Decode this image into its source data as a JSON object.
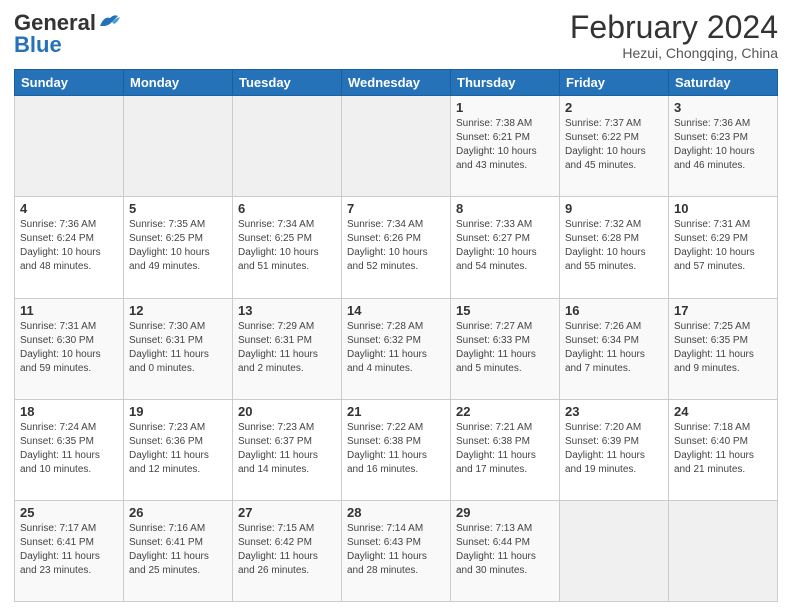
{
  "header": {
    "logo_line1": "General",
    "logo_line2": "Blue",
    "month_year": "February 2024",
    "location": "Hezui, Chongqing, China"
  },
  "days_of_week": [
    "Sunday",
    "Monday",
    "Tuesday",
    "Wednesday",
    "Thursday",
    "Friday",
    "Saturday"
  ],
  "weeks": [
    [
      {
        "day": "",
        "info": ""
      },
      {
        "day": "",
        "info": ""
      },
      {
        "day": "",
        "info": ""
      },
      {
        "day": "",
        "info": ""
      },
      {
        "day": "1",
        "info": "Sunrise: 7:38 AM\nSunset: 6:21 PM\nDaylight: 10 hours\nand 43 minutes."
      },
      {
        "day": "2",
        "info": "Sunrise: 7:37 AM\nSunset: 6:22 PM\nDaylight: 10 hours\nand 45 minutes."
      },
      {
        "day": "3",
        "info": "Sunrise: 7:36 AM\nSunset: 6:23 PM\nDaylight: 10 hours\nand 46 minutes."
      }
    ],
    [
      {
        "day": "4",
        "info": "Sunrise: 7:36 AM\nSunset: 6:24 PM\nDaylight: 10 hours\nand 48 minutes."
      },
      {
        "day": "5",
        "info": "Sunrise: 7:35 AM\nSunset: 6:25 PM\nDaylight: 10 hours\nand 49 minutes."
      },
      {
        "day": "6",
        "info": "Sunrise: 7:34 AM\nSunset: 6:25 PM\nDaylight: 10 hours\nand 51 minutes."
      },
      {
        "day": "7",
        "info": "Sunrise: 7:34 AM\nSunset: 6:26 PM\nDaylight: 10 hours\nand 52 minutes."
      },
      {
        "day": "8",
        "info": "Sunrise: 7:33 AM\nSunset: 6:27 PM\nDaylight: 10 hours\nand 54 minutes."
      },
      {
        "day": "9",
        "info": "Sunrise: 7:32 AM\nSunset: 6:28 PM\nDaylight: 10 hours\nand 55 minutes."
      },
      {
        "day": "10",
        "info": "Sunrise: 7:31 AM\nSunset: 6:29 PM\nDaylight: 10 hours\nand 57 minutes."
      }
    ],
    [
      {
        "day": "11",
        "info": "Sunrise: 7:31 AM\nSunset: 6:30 PM\nDaylight: 10 hours\nand 59 minutes."
      },
      {
        "day": "12",
        "info": "Sunrise: 7:30 AM\nSunset: 6:31 PM\nDaylight: 11 hours\nand 0 minutes."
      },
      {
        "day": "13",
        "info": "Sunrise: 7:29 AM\nSunset: 6:31 PM\nDaylight: 11 hours\nand 2 minutes."
      },
      {
        "day": "14",
        "info": "Sunrise: 7:28 AM\nSunset: 6:32 PM\nDaylight: 11 hours\nand 4 minutes."
      },
      {
        "day": "15",
        "info": "Sunrise: 7:27 AM\nSunset: 6:33 PM\nDaylight: 11 hours\nand 5 minutes."
      },
      {
        "day": "16",
        "info": "Sunrise: 7:26 AM\nSunset: 6:34 PM\nDaylight: 11 hours\nand 7 minutes."
      },
      {
        "day": "17",
        "info": "Sunrise: 7:25 AM\nSunset: 6:35 PM\nDaylight: 11 hours\nand 9 minutes."
      }
    ],
    [
      {
        "day": "18",
        "info": "Sunrise: 7:24 AM\nSunset: 6:35 PM\nDaylight: 11 hours\nand 10 minutes."
      },
      {
        "day": "19",
        "info": "Sunrise: 7:23 AM\nSunset: 6:36 PM\nDaylight: 11 hours\nand 12 minutes."
      },
      {
        "day": "20",
        "info": "Sunrise: 7:23 AM\nSunset: 6:37 PM\nDaylight: 11 hours\nand 14 minutes."
      },
      {
        "day": "21",
        "info": "Sunrise: 7:22 AM\nSunset: 6:38 PM\nDaylight: 11 hours\nand 16 minutes."
      },
      {
        "day": "22",
        "info": "Sunrise: 7:21 AM\nSunset: 6:38 PM\nDaylight: 11 hours\nand 17 minutes."
      },
      {
        "day": "23",
        "info": "Sunrise: 7:20 AM\nSunset: 6:39 PM\nDaylight: 11 hours\nand 19 minutes."
      },
      {
        "day": "24",
        "info": "Sunrise: 7:18 AM\nSunset: 6:40 PM\nDaylight: 11 hours\nand 21 minutes."
      }
    ],
    [
      {
        "day": "25",
        "info": "Sunrise: 7:17 AM\nSunset: 6:41 PM\nDaylight: 11 hours\nand 23 minutes."
      },
      {
        "day": "26",
        "info": "Sunrise: 7:16 AM\nSunset: 6:41 PM\nDaylight: 11 hours\nand 25 minutes."
      },
      {
        "day": "27",
        "info": "Sunrise: 7:15 AM\nSunset: 6:42 PM\nDaylight: 11 hours\nand 26 minutes."
      },
      {
        "day": "28",
        "info": "Sunrise: 7:14 AM\nSunset: 6:43 PM\nDaylight: 11 hours\nand 28 minutes."
      },
      {
        "day": "29",
        "info": "Sunrise: 7:13 AM\nSunset: 6:44 PM\nDaylight: 11 hours\nand 30 minutes."
      },
      {
        "day": "",
        "info": ""
      },
      {
        "day": "",
        "info": ""
      }
    ]
  ]
}
